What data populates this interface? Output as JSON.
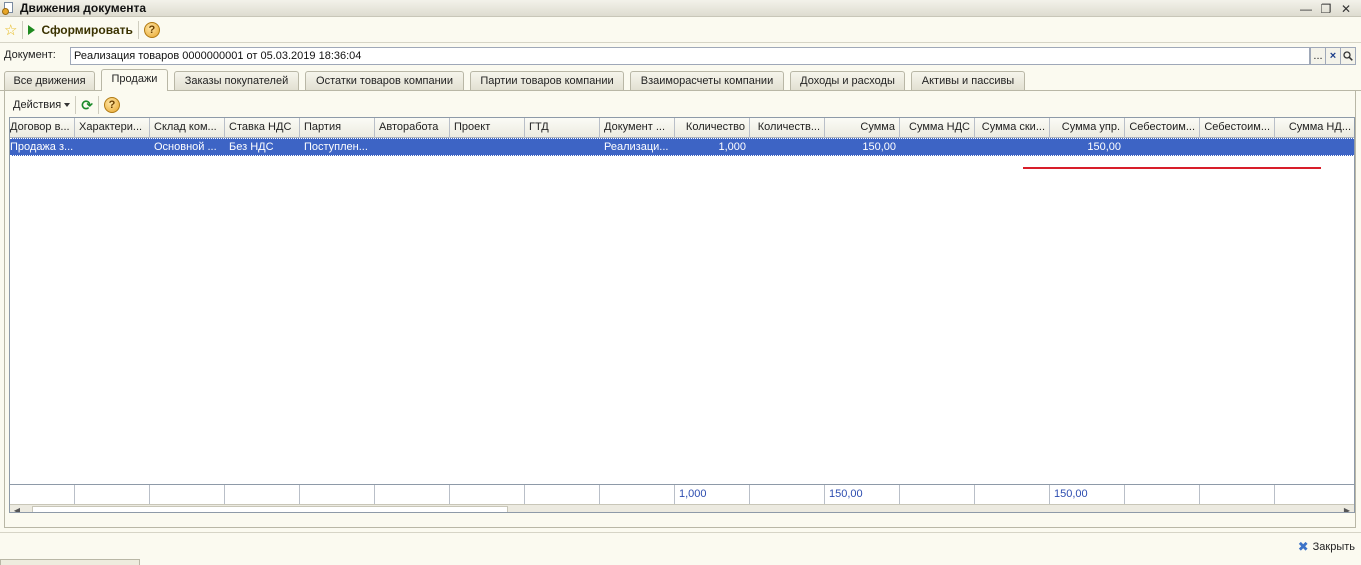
{
  "window": {
    "title": "Движения документа"
  },
  "toolbar": {
    "run_label": "Сформировать",
    "help": "?"
  },
  "document": {
    "label": "Документ:",
    "value": "Реализация товаров 0000000001 от 05.03.2019 18:36:04",
    "select_btn": "...",
    "clear_btn": "×"
  },
  "tabs": [
    "Все движения",
    "Продажи",
    "Заказы покупателей",
    "Остатки товаров компании",
    "Партии товаров компании",
    "Взаиморасчеты компании",
    "Доходы и расходы",
    "Активы и пассивы"
  ],
  "active_tab": 1,
  "panel": {
    "actions_label": "Действия",
    "help": "?"
  },
  "grid": {
    "columns": [
      "Договор в...",
      "Характери...",
      "Склад ком...",
      "Ставка НДС",
      "Партия",
      "Авторабота",
      "Проект",
      "ГТД",
      "Документ ...",
      "Количество",
      "Количеств...",
      "Сумма",
      "Сумма НДС",
      "Сумма ски...",
      "Сумма упр.",
      "Себестоим...",
      "Себестоим...",
      "Сумма НД..."
    ],
    "rows": [
      [
        "Продажа з...",
        "",
        "Основной ...",
        "Без НДС",
        "Поступлен...",
        "",
        "",
        "",
        "Реализаци...",
        "1,000",
        "",
        "150,00",
        "",
        "",
        "150,00",
        "",
        "",
        ""
      ]
    ],
    "totals": [
      "",
      "",
      "",
      "",
      "",
      "",
      "",
      "",
      "",
      "1,000",
      "",
      "150,00",
      "",
      "",
      "150,00",
      "",
      "",
      ""
    ]
  },
  "footer": {
    "close_label": "Закрыть"
  }
}
